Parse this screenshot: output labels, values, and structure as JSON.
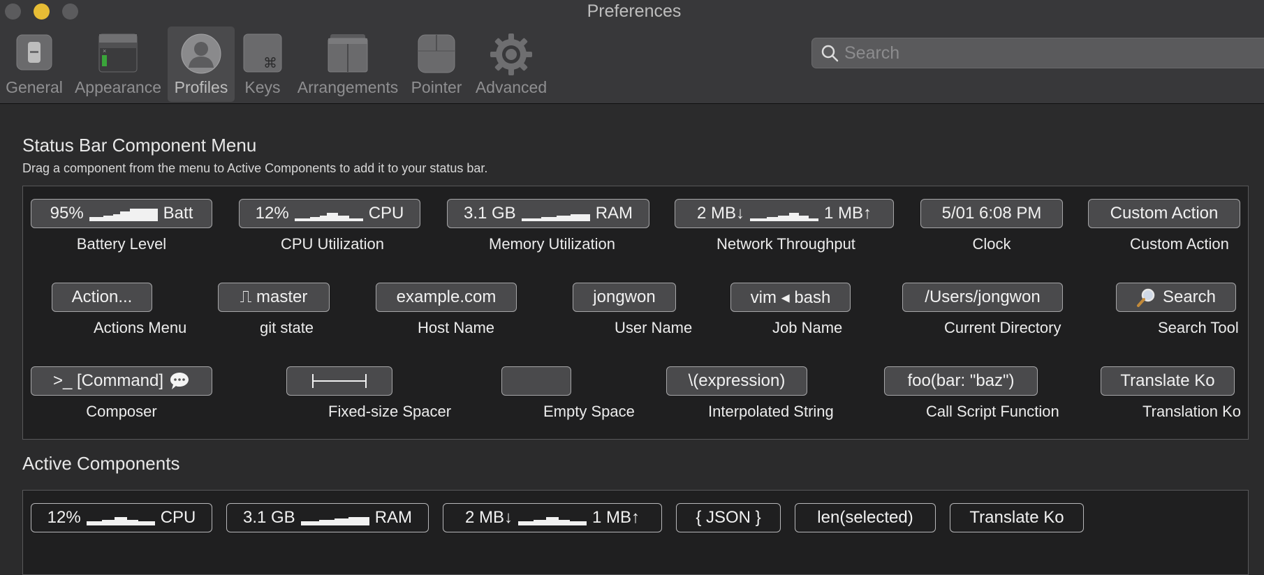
{
  "window": {
    "title": "Preferences"
  },
  "toolbar": {
    "tabs": [
      {
        "label": "General",
        "icon": "switch-icon"
      },
      {
        "label": "Appearance",
        "icon": "terminal-window-icon"
      },
      {
        "label": "Profiles",
        "icon": "user-silhouette-icon",
        "selected": true
      },
      {
        "label": "Keys",
        "icon": "command-key-icon"
      },
      {
        "label": "Arrangements",
        "icon": "window-stack-icon"
      },
      {
        "label": "Pointer",
        "icon": "mouse-icon"
      },
      {
        "label": "Advanced",
        "icon": "gear-icon"
      }
    ],
    "search": {
      "placeholder": "Search",
      "value": ""
    }
  },
  "menu": {
    "title": "Status Bar Component Menu",
    "description": "Drag a component from the menu to Active Components to add it to your status bar.",
    "components": [
      {
        "pill": {
          "left": "95%",
          "right": "Batt",
          "spark": true
        },
        "label": "Battery Level"
      },
      {
        "pill": {
          "left": "12%",
          "right": "CPU",
          "spark": true
        },
        "label": "CPU Utilization"
      },
      {
        "pill": {
          "left": "3.1 GB",
          "right": "RAM",
          "spark": true
        },
        "label": "Memory Utilization"
      },
      {
        "pill": {
          "left": "2 MB↓",
          "right": "1 MB↑",
          "spark": true
        },
        "label": "Network Throughput"
      },
      {
        "pill": {
          "text": "5/01 6:08 PM"
        },
        "label": "Clock"
      },
      {
        "pill": {
          "text": "Custom Action"
        },
        "label": "Custom Action"
      },
      {
        "pill": {
          "text": "Action..."
        },
        "label": "Actions Menu"
      },
      {
        "pill": {
          "text": "⎍ master",
          "icon": "git-branch-icon"
        },
        "label": "git state"
      },
      {
        "pill": {
          "text": "example.com"
        },
        "label": "Host Name"
      },
      {
        "pill": {
          "text": "jongwon"
        },
        "label": "User Name"
      },
      {
        "pill": {
          "text": "vim ◂ bash"
        },
        "label": "Job Name"
      },
      {
        "pill": {
          "text": "/Users/jongwon"
        },
        "label": "Current Directory"
      },
      {
        "pill": {
          "text": "Search",
          "icon": "magnifier-icon"
        },
        "label": "Search Tool"
      },
      {
        "pill": {
          "text": ">_ [Command]",
          "icon": "speech-bubble-icon"
        },
        "label": "Composer"
      },
      {
        "pill": {
          "text": "",
          "icon": "spacer-bracket-icon"
        },
        "label": "Fixed-size Spacer"
      },
      {
        "pill": {
          "text": ""
        },
        "label": "Empty Space"
      },
      {
        "pill": {
          "text": "\\(expression)"
        },
        "label": "Interpolated String"
      },
      {
        "pill": {
          "text": "foo(bar: \"baz\")"
        },
        "label": "Call Script Function"
      },
      {
        "pill": {
          "text": "Translate Ko"
        },
        "label": "Translation Ko"
      }
    ]
  },
  "active": {
    "title": "Active Components",
    "components": [
      {
        "left": "12%",
        "right": "CPU",
        "spark": true
      },
      {
        "left": "3.1 GB",
        "right": "RAM",
        "spark": true
      },
      {
        "left": "2 MB↓",
        "right": "1 MB↑",
        "spark": true
      },
      {
        "text": "{ JSON }"
      },
      {
        "text": "len(selected)"
      },
      {
        "text": "Translate Ko"
      }
    ]
  },
  "colors": {
    "toolbar": "#38383a",
    "window": "#2b2b2c",
    "panel": "#1f1f20",
    "pill": "#4a4a4c",
    "traffic_minimize": "#e7bd35"
  }
}
